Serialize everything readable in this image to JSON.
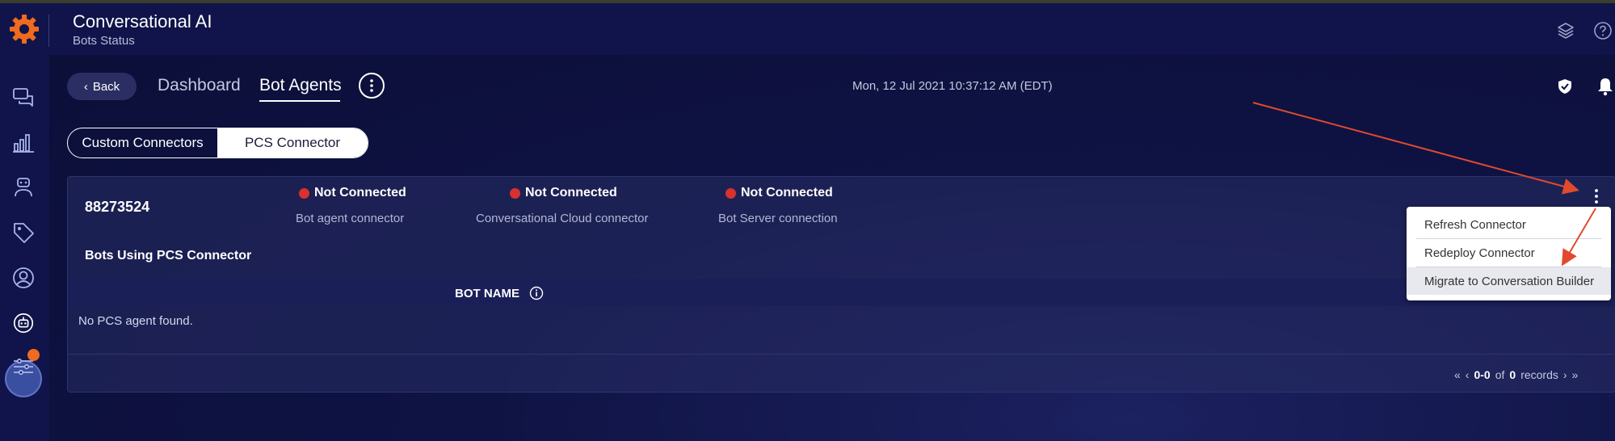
{
  "header": {
    "title": "Conversational AI",
    "subtitle": "Bots Status"
  },
  "nav": {
    "back_label": "Back",
    "tabs": [
      {
        "label": "Dashboard"
      },
      {
        "label": "Bot Agents"
      }
    ]
  },
  "datetime": "Mon, 12 Jul 2021 10:37:12 AM (EDT)",
  "segments": [
    {
      "label": "Custom Connectors"
    },
    {
      "label": "PCS Connector"
    }
  ],
  "connector": {
    "id": "88273524",
    "statuses": [
      {
        "state": "Not Connected",
        "desc": "Bot agent connector"
      },
      {
        "state": "Not Connected",
        "desc": "Conversational Cloud connector"
      },
      {
        "state": "Not Connected",
        "desc": "Bot Server connection"
      }
    ],
    "section_title": "Bots Using PCS Connector",
    "table": {
      "col_bot_name": "BOT NAME",
      "empty_message": "No PCS agent found."
    },
    "pager": {
      "range": "0-0",
      "of": "of",
      "total": "0",
      "suffix": "records"
    }
  },
  "menu": {
    "items": [
      "Refresh Connector",
      "Redeploy Connector",
      "Migrate to Conversation Builder"
    ]
  },
  "colors": {
    "status_red": "#d8312f",
    "accent_orange": "#f06a1f",
    "annotation_arrow": "#e04a2f"
  }
}
